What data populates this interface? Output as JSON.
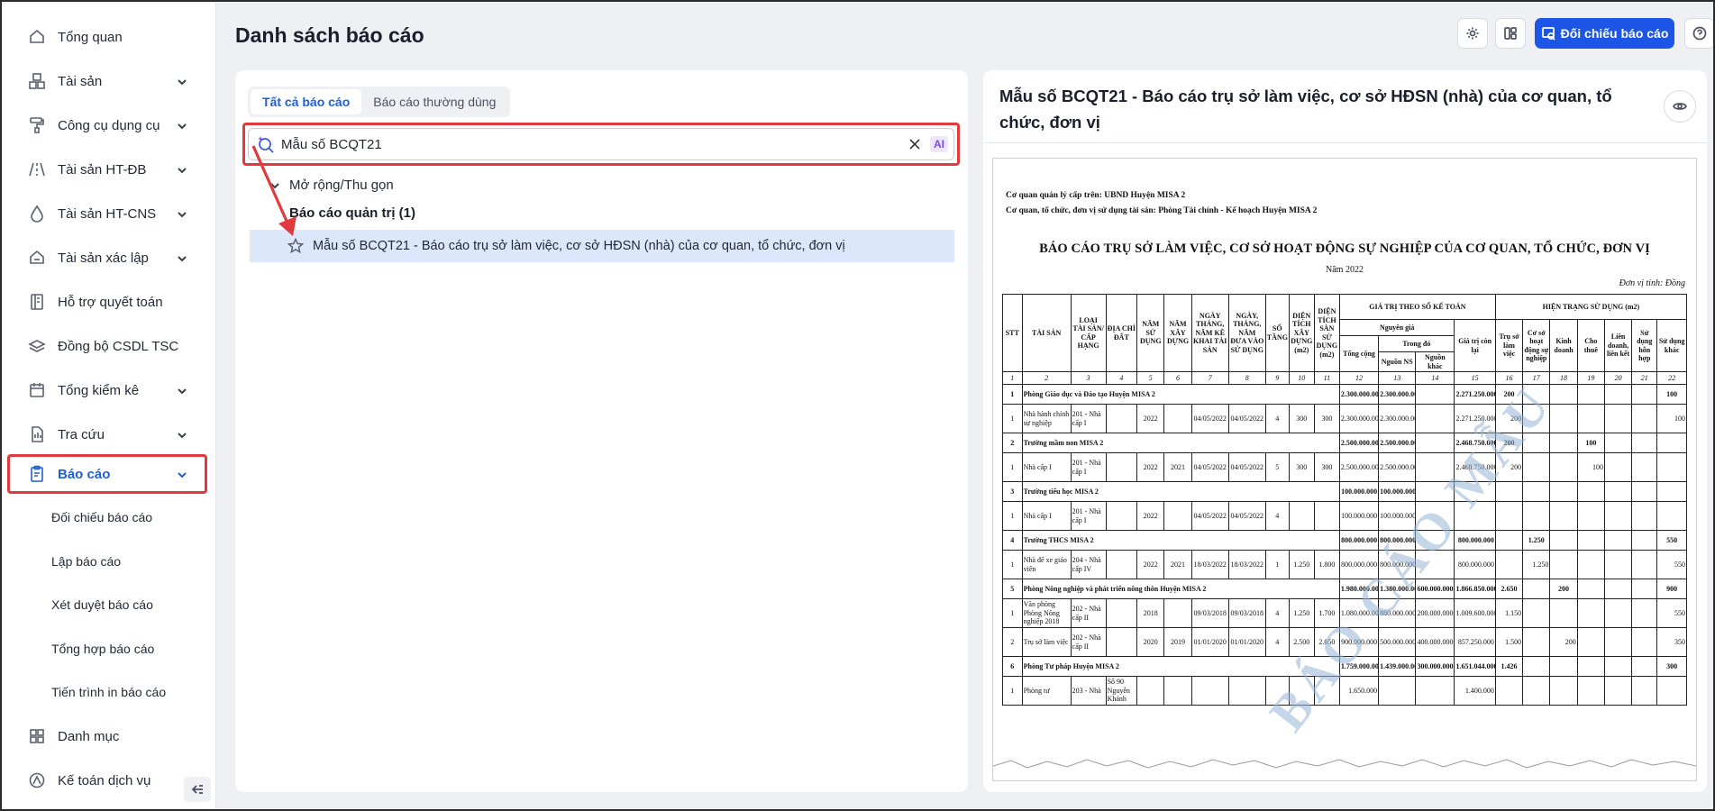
{
  "sidebar": {
    "items": [
      {
        "label": "Tổng quan",
        "icon": "home-icon"
      },
      {
        "label": "Tài sản",
        "icon": "cubes-icon"
      },
      {
        "label": "Công cụ dụng cụ",
        "icon": "paint-roller-icon"
      },
      {
        "label": "Tài sản HT-ĐB",
        "icon": "road-icon"
      },
      {
        "label": "Tài sản HT-CNS",
        "icon": "water-drop-icon"
      },
      {
        "label": "Tài sản xác lập",
        "icon": "home-check-icon"
      },
      {
        "label": "Hỗ trợ quyết toán",
        "icon": "ledger-icon"
      },
      {
        "label": "Đồng bộ CSDL TSC",
        "icon": "layers-sync-icon"
      },
      {
        "label": "Tổng kiểm kê",
        "icon": "calendar-icon"
      },
      {
        "label": "Tra cứu",
        "icon": "search-doc-icon"
      },
      {
        "label": "Báo cáo",
        "icon": "clipboard-report-icon"
      }
    ],
    "sub_items": [
      "Đối chiếu báo cáo",
      "Lập báo cáo",
      "Xét duyệt báo cáo",
      "Tổng hợp báo cáo",
      "Tiến trình in báo cáo"
    ],
    "bottom_items": [
      {
        "label": "Danh mục",
        "icon": "grid-icon"
      },
      {
        "label": "Kế toán dịch vụ",
        "icon": "service-icon"
      }
    ]
  },
  "header": {
    "title": "Danh sách báo cáo",
    "primary_button": "Đối chiếu báo cáo"
  },
  "left_panel": {
    "tabs": [
      "Tất cả báo cáo",
      "Báo cáo thường dùng"
    ],
    "search_value": "Mẫu số BCQT21",
    "ai_badge": "AI",
    "expand_label": "Mở rộng/Thu gọn",
    "group_label": "Báo cáo quản trị (1)",
    "result": "Mẫu số BCQT21 - Báo cáo trụ sở làm việc, cơ sở HĐSN (nhà) của cơ quan, tổ chức, đơn vị"
  },
  "preview": {
    "title": "Mẫu số BCQT21 - Báo cáo trụ sở làm việc, cơ sở HĐSN (nhà) của cơ quan, tổ chức, đơn vị",
    "doc": {
      "line1": "Cơ quan quản lý cấp trên: UBND Huyện MISA 2",
      "line2": "Cơ quan, tổ chức, đơn vị sử dụng tài sản: Phòng Tài chính - Kế hoạch Huyện MISA 2",
      "title": "BÁO CÁO TRỤ SỞ LÀM VIỆC, CƠ SỞ HOẠT ĐỘNG SỰ NGHIỆP CỦA CƠ QUAN, TỔ CHỨC, ĐƠN VỊ",
      "year": "Năm 2022",
      "unit": "Đơn vị tính: Đồng",
      "watermark": "BÁO CÁO MẪU",
      "headers": {
        "stt": "STT",
        "tai_san": "TÀI SẢN",
        "loai": "LOẠI TÀI SẢN/ CẤP HẠNG",
        "dia_chi": "ĐỊA CHỈ ĐẤT",
        "nam_su_dung": "NĂM SỬ DỤNG",
        "nam_xay_dung": "NĂM XÂY DỰNG",
        "ngay_ke_khai": "NGÀY THÁNG, NĂM KÊ KHAI TÀI SẢN",
        "ngay_dua_vao": "NGÀY, THÁNG, NĂM ĐƯA VÀO SỬ DỤNG",
        "so_tang": "SỐ TẦNG",
        "dt_xay_dung": "DIỆN TÍCH XÂY DỰNG (m2)",
        "dt_san": "DIỆN TÍCH SÀN SỬ DỤNG (m2)",
        "gia_tri": "GIÁ TRỊ THEO SỔ KẾ TOÁN",
        "nguyen_gia": "Nguyên giá",
        "tong_cong": "Tổng cộng",
        "trong_do": "Trong đó",
        "nguon_ns": "Nguồn NS",
        "nguon_khac": "Nguồn khác",
        "gia_tri_con_lai": "Giá trị còn lại",
        "hien_trang": "HIỆN TRẠNG SỬ DỤNG (m2)",
        "tru_so": "Trụ sở làm việc",
        "co_so_hd": "Cơ sở hoạt động sự nghiệp",
        "kinh_doanh": "Kinh doanh",
        "cho_thue": "Cho thuê",
        "lien_doanh": "Liên doanh, liên kết",
        "su_dung_hon_hop": "Sử dụng hỗn hợp",
        "su_dung_khac": "Sử dụng khác"
      },
      "index_row": [
        "1",
        "2",
        "3",
        "4",
        "5",
        "6",
        "7",
        "8",
        "9",
        "10",
        "11",
        "12",
        "13",
        "14",
        "15",
        "16",
        "17",
        "18",
        "19",
        "20",
        "21",
        "22"
      ],
      "rows": [
        {
          "type": "group",
          "cells": [
            "1",
            "Phòng Giáo dục và Đào tạo Huyện MISA 2",
            "2.300.000.000",
            "2.300.000.000",
            "",
            "2.271.250.000",
            "200",
            "",
            "",
            "",
            "",
            "",
            "100"
          ]
        },
        {
          "type": "item",
          "cells": [
            "1",
            "Nhà hành chính sự nghiệp",
            "201 - Nhà cấp I",
            "",
            "2022",
            "",
            "04/05/2022",
            "04/05/2022",
            "4",
            "300",
            "300",
            "2.300.000.000",
            "2.300.000.000",
            "",
            "2.271.250.000",
            "200",
            "",
            "",
            "",
            "",
            "",
            "100"
          ]
        },
        {
          "type": "group",
          "cells": [
            "2",
            "Trường mầm non MISA 2",
            "2.500.000.000",
            "2.500.000.000",
            "",
            "2.468.750.000",
            "200",
            "",
            "",
            "100",
            "",
            "",
            ""
          ]
        },
        {
          "type": "item",
          "cells": [
            "1",
            "Nhà cấp I",
            "201 - Nhà cấp I",
            "",
            "2022",
            "2021",
            "04/05/2022",
            "04/05/2022",
            "5",
            "300",
            "300",
            "2.500.000.000",
            "2.500.000.000",
            "",
            "2.468.750.000",
            "200",
            "",
            "",
            "100",
            "",
            "",
            ""
          ]
        },
        {
          "type": "group",
          "cells": [
            "3",
            "Trường tiểu học MISA 2",
            "100.000.000",
            "100.000.000",
            "",
            "",
            "",
            "",
            "",
            "",
            "",
            "",
            ""
          ]
        },
        {
          "type": "item",
          "cells": [
            "1",
            "Nhà cấp I",
            "201 - Nhà cấp I",
            "",
            "2022",
            "",
            "04/05/2022",
            "04/05/2022",
            "4",
            "",
            "",
            "100.000.000",
            "100.000.000",
            "",
            "",
            "",
            "",
            "",
            "",
            "",
            "",
            ""
          ]
        },
        {
          "type": "group",
          "cells": [
            "4",
            "Trường THCS MISA 2",
            "800.000.000",
            "800.000.000",
            "",
            "800.000.000",
            "",
            "1.250",
            "",
            "",
            "",
            "",
            "550"
          ]
        },
        {
          "type": "item",
          "cells": [
            "1",
            "Nhà để xe giáo viên",
            "204 - Nhà cấp IV",
            "",
            "2022",
            "2021",
            "18/03/2022",
            "18/03/2022",
            "1",
            "1.250",
            "1.800",
            "800.000.000",
            "800.000.000",
            "",
            "800.000.000",
            "",
            "1.250",
            "",
            "",
            "",
            "",
            "550"
          ]
        },
        {
          "type": "group",
          "cells": [
            "5",
            "Phòng Nông nghiệp và phát triển nông thôn Huyện MISA 2",
            "1.980.000.000",
            "1.380.000.000",
            "600.000.000",
            "1.866.850.000",
            "2.650",
            "",
            "200",
            "",
            "",
            "",
            "900"
          ]
        },
        {
          "type": "item",
          "cells": [
            "1",
            "Văn phòng Phòng Nông nghiệp 2018",
            "202 - Nhà cấp II",
            "",
            "2018",
            "",
            "09/03/2018",
            "09/03/2018",
            "4",
            "1.250",
            "1.700",
            "1.080.000.000",
            "880.000.000",
            "200.000.000",
            "1.009.600.000",
            "1.150",
            "",
            "",
            "",
            "",
            "",
            "550"
          ]
        },
        {
          "type": "item",
          "cells": [
            "2",
            "Trụ sở làm việc",
            "202 - Nhà cấp II",
            "",
            "2020",
            "2019",
            "01/01/2020",
            "01/01/2020",
            "4",
            "2.500",
            "2.050",
            "900.000.000",
            "500.000.000",
            "400.000.000",
            "857.250.000",
            "1.500",
            "",
            "200",
            "",
            "",
            "",
            "350"
          ]
        },
        {
          "type": "group",
          "cells": [
            "6",
            "Phòng Tư pháp Huyện MISA 2",
            "1.759.000.000",
            "1.439.000.000",
            "300.000.000",
            "1.651.044.000",
            "1.426",
            "",
            "",
            "",
            "",
            "",
            "300"
          ]
        },
        {
          "type": "item",
          "cells": [
            "1",
            "Phòng tư",
            "203 - Nhà",
            "Số 90 Nguyễn Khánh",
            "",
            "",
            "",
            "",
            "",
            "",
            "",
            "1.650.000",
            "",
            "",
            "1.400.000",
            "",
            "",
            "",
            "",
            "",
            "",
            ""
          ]
        }
      ]
    }
  },
  "colors": {
    "accent": "#1d56e6",
    "highlight_box": "#e03a3e",
    "selected_row": "#dce7fb"
  }
}
